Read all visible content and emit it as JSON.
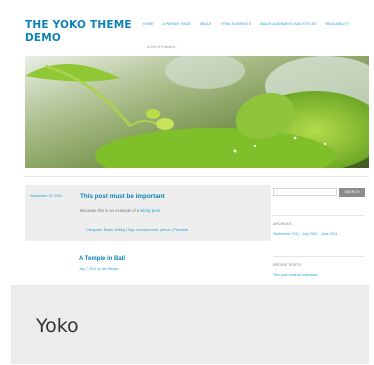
{
  "preview": {
    "site_title": "THE YOKO THEME DEMO",
    "nav_items": [
      "HOME",
      "A PARENT PAGE",
      "ABOUT",
      "HTML ELEMENTS",
      "IMAGE ALIGNMENT AND STYLES",
      "READABILITY"
    ],
    "tagline": "A test of 5 distinct...",
    "sticky_post": {
      "date": "September 20, 2011",
      "title": "This post must be important",
      "excerpt": "Because this is an example of a",
      "excerpt_link": "sticky post.",
      "meta": "Categories: Books, Writing  |  Tags: announcement, pseudo  |  Permalink"
    },
    "second_post": {
      "title": "A Temple in Bali",
      "date": "July 7, 2011 by Ian Stewart"
    },
    "sidebar": {
      "search_button": "SEARCH",
      "archives_heading": "ARCHIVES",
      "archives_links": "September 2011  ·  July 2011  ·  June 2011",
      "recent_heading": "RECENT POSTS",
      "recent_link": "This post must be important"
    }
  },
  "theme": {
    "name": "Yoko"
  }
}
